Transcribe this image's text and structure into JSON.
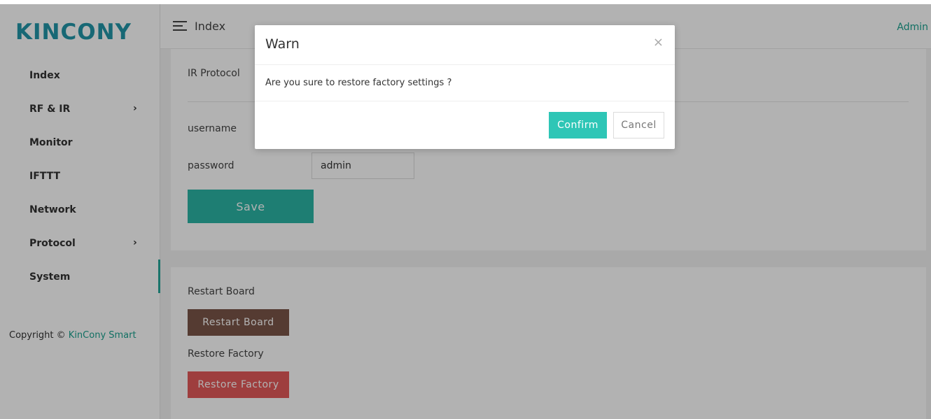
{
  "brand": {
    "logo": "KINCONY"
  },
  "sidebar": {
    "items": [
      {
        "label": "Index"
      },
      {
        "label": "RF & IR"
      },
      {
        "label": "Monitor"
      },
      {
        "label": "IFTTT"
      },
      {
        "label": "Network"
      },
      {
        "label": "Protocol"
      },
      {
        "label": "System"
      }
    ],
    "copyright_prefix": "Copyright ©",
    "copyright_brand": "KinCony Smart"
  },
  "header": {
    "title": "Index",
    "user": "Admin"
  },
  "settings": {
    "ir_protocol_label": "IR Protocol",
    "username_label": "username",
    "password_label": "password",
    "password_value": "admin",
    "save_label": "Save"
  },
  "system": {
    "restart_label": "Restart Board",
    "restart_button": "Restart Board",
    "restore_label": "Restore Factory",
    "restore_button": "Restore Factory"
  },
  "modal": {
    "title": "Warn",
    "close": "×",
    "message": "Are you sure to restore factory settings ?",
    "confirm": "Confirm",
    "cancel": "Cancel"
  },
  "colors": {
    "brand_blue": "#2196a8",
    "accent_teal": "#2bb5a5",
    "restart_brown": "#7a5548",
    "restore_red": "#e25a5a"
  }
}
